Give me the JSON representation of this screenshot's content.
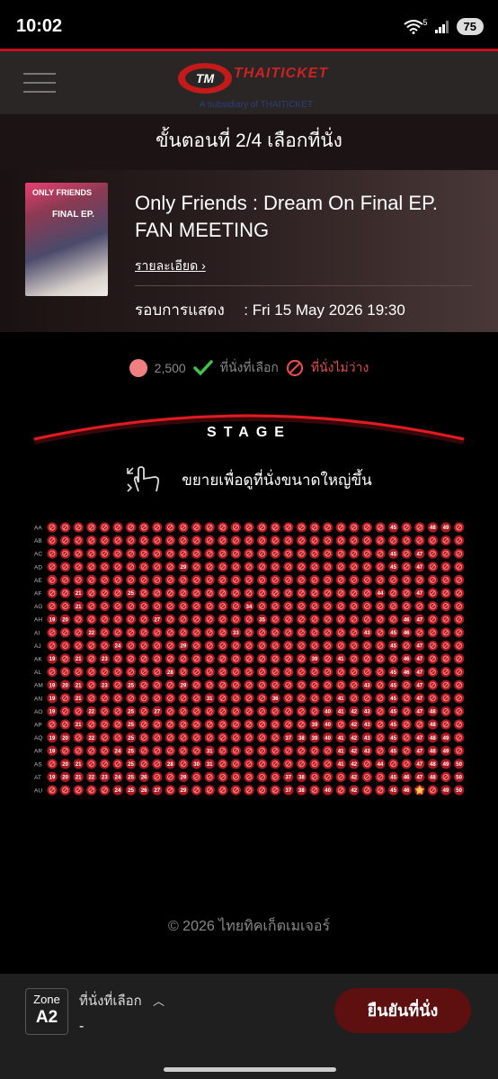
{
  "status": {
    "time": "10:02",
    "battery": "75",
    "net_sup": "5"
  },
  "header": {
    "logo_text": "THAITICKET",
    "logo_sub": "A subsidiary of THAITICKET",
    "step": "ขั้นตอนที่ 2/4 เลือกที่นั่ง"
  },
  "event": {
    "title": "Only Friends : Dream On Final EP. FAN MEETING",
    "detail_link": "รายละเอียด",
    "showtime_label": "รอบการแสดง",
    "showtime_value": ": Fri 15 May 2026 19:30",
    "poster_text_a": "ONLY FRIENDS",
    "poster_text_b": "FINAL EP."
  },
  "legend": {
    "price": "2,500",
    "selected": "ที่นั่งที่เลือก",
    "unavailable": "ที่นั่งไม่ว่าง",
    "colors": {
      "available": "#f08080",
      "unavailable": "#b01820",
      "selected": "#3fc34a"
    }
  },
  "stage": {
    "label": "STAGE",
    "zoom_hint": "ขยายเพื่อดูที่นั่งขนาดใหญ่ขึ้น"
  },
  "seatmap": {
    "rows": [
      "AA",
      "AB",
      "AC",
      "AD",
      "AE",
      "AF",
      "AG",
      "AH",
      "AI",
      "AJ",
      "AK",
      "AL",
      "AM",
      "AN",
      "AO",
      "AP",
      "AQ",
      "AR",
      "AS",
      "AT",
      "AU"
    ],
    "first_seat": 19,
    "last_seat": 50,
    "numbered_seats": {
      "AA": [
        45,
        48,
        49
      ],
      "AB": [],
      "AC": [
        45,
        47
      ],
      "AD": [
        29,
        45,
        47
      ],
      "AE": [],
      "AF": [
        21,
        25,
        44,
        47
      ],
      "AG": [
        21,
        34
      ],
      "AH": [
        19,
        20,
        27,
        35,
        46,
        47
      ],
      "AI": [
        22,
        33,
        43,
        45,
        46
      ],
      "AJ": [
        24,
        29,
        45,
        47
      ],
      "AK": [
        19,
        21,
        23,
        39,
        41,
        46,
        47
      ],
      "AL": [
        28,
        45,
        46,
        47
      ],
      "AM": [
        19,
        20,
        21,
        23,
        25,
        29,
        43,
        45,
        47
      ],
      "AN": [
        19,
        21,
        31,
        36,
        41,
        45,
        47
      ],
      "AO": [
        19,
        22,
        25,
        27,
        40,
        41,
        42,
        43,
        45,
        47,
        48
      ],
      "AP": [
        21,
        25,
        39,
        40,
        42,
        43,
        45,
        48
      ],
      "AQ": [
        19,
        20,
        22,
        25,
        37,
        38,
        39,
        40,
        41,
        42,
        43,
        45,
        47,
        48,
        49
      ],
      "AR": [
        19,
        24,
        25,
        31,
        41,
        42,
        43,
        45,
        47,
        48,
        49
      ],
      "AS": [
        20,
        21,
        25,
        28,
        30,
        31,
        41,
        42,
        44,
        47,
        48,
        49,
        50
      ],
      "AT": [
        19,
        20,
        21,
        22,
        23,
        24,
        25,
        26,
        29,
        37,
        38,
        42,
        45,
        46,
        47,
        48,
        50
      ],
      "AU": [
        24,
        25,
        26,
        27,
        29,
        37,
        38,
        40,
        42,
        45,
        46,
        49,
        50
      ]
    },
    "star_seat": "AU-47"
  },
  "footer": {
    "copyright": "© 2026 ไทยทิคเก็ตเมเจอร์"
  },
  "bottom": {
    "zone_label": "Zone",
    "zone_value": "A2",
    "selected_label": "ที่นั่งที่เลือก",
    "selected_value": "-",
    "confirm": "ยืนยันที่นั่ง"
  }
}
